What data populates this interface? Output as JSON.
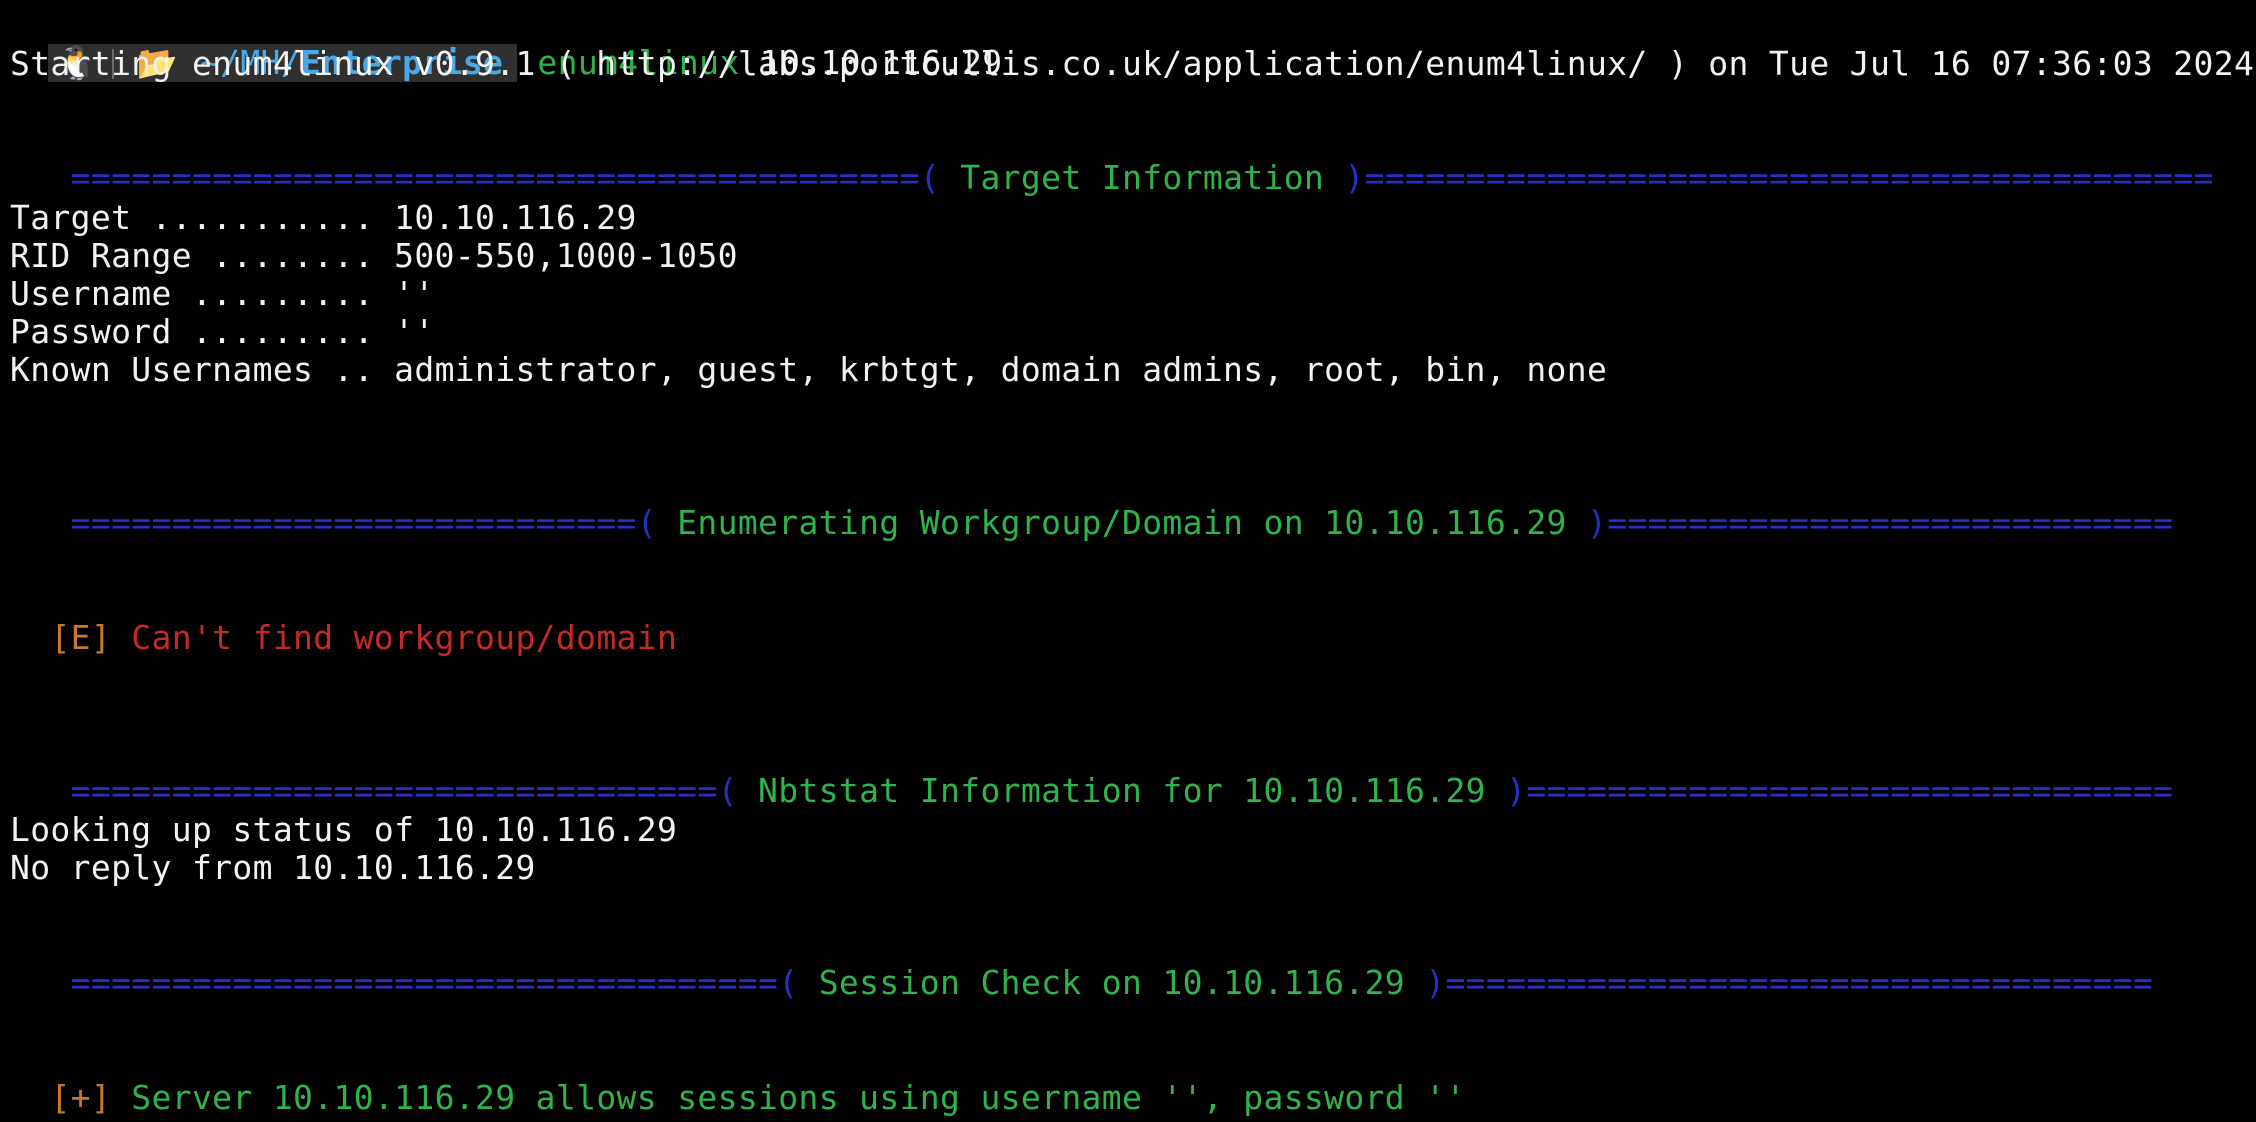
{
  "prompt": {
    "os_icon": "linux-tux-icon",
    "folder_icon": "folder-open-icon",
    "path_prefix": "~/MH/",
    "path_current": "Enterprise",
    "command": "enum4linux",
    "argument": "10.10.116.29"
  },
  "banner": "Starting enum4linux v0.9.1 ( http://labs.portcullis.co.uk/application/enum4linux/ ) on Tue Jul 16 07:36:03 2024",
  "sections": {
    "target": {
      "rule_left": " ==========================================(",
      "title": " Target Information ",
      "rule_right": ")=========================================="
    },
    "workgroup": {
      "rule_left": " ============================(",
      "title": " Enumerating Workgroup/Domain on 10.10.116.29 ",
      "rule_right": ")============================"
    },
    "nbtstat": {
      "rule_left": " ================================(",
      "title": " Nbtstat Information for 10.10.116.29 ",
      "rule_right": ")================================"
    },
    "session": {
      "rule_left": " ===================================(",
      "title": " Session Check on 10.10.116.29 ",
      "rule_right": ")==================================="
    }
  },
  "target_info": {
    "target": "Target ........... 10.10.116.29",
    "rid_range": "RID Range ........ 500-550,1000-1050",
    "username": "Username ......... ''",
    "password": "Password ......... ''",
    "known_usernames": "Known Usernames .. administrator, guest, krbtgt, domain admins, root, bin, none"
  },
  "workgroup_result": {
    "tag": "[E]",
    "message": " Can't find workgroup/domain"
  },
  "nbtstat_result": {
    "line1": "Looking up status of 10.10.116.29",
    "line2": "No reply from 10.10.116.29"
  },
  "session_result": {
    "tag": "[+]",
    "message": " Server 10.10.116.29 allows sessions using username '', password ''"
  },
  "colors": {
    "background": "#000000",
    "text": "#f2f2f2",
    "heading_green": "#2fb34a",
    "rule_blue": "#2430c8",
    "error_red": "#c42a26",
    "tag_orange": "#c8782c",
    "path_blue": "#4aa8e6"
  }
}
